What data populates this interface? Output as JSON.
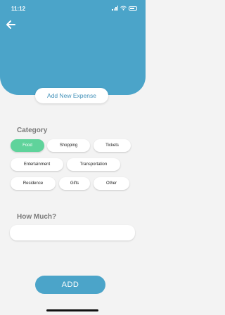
{
  "status_bar": {
    "time": "11:12"
  },
  "header": {
    "title": "Add New Expense",
    "back_icon": "arrow-left-icon",
    "color": "#4ba4c9"
  },
  "category": {
    "label": "Category",
    "selected": "Food",
    "options": [
      "Food",
      "Shopping",
      "Tickets",
      "Entertainment",
      "Transportation",
      "Residence",
      "Gifts",
      "Other"
    ],
    "selected_color": "#5fd39b"
  },
  "amount": {
    "label": "How Much?",
    "value": "",
    "placeholder": ""
  },
  "submit": {
    "label": "ADD"
  }
}
